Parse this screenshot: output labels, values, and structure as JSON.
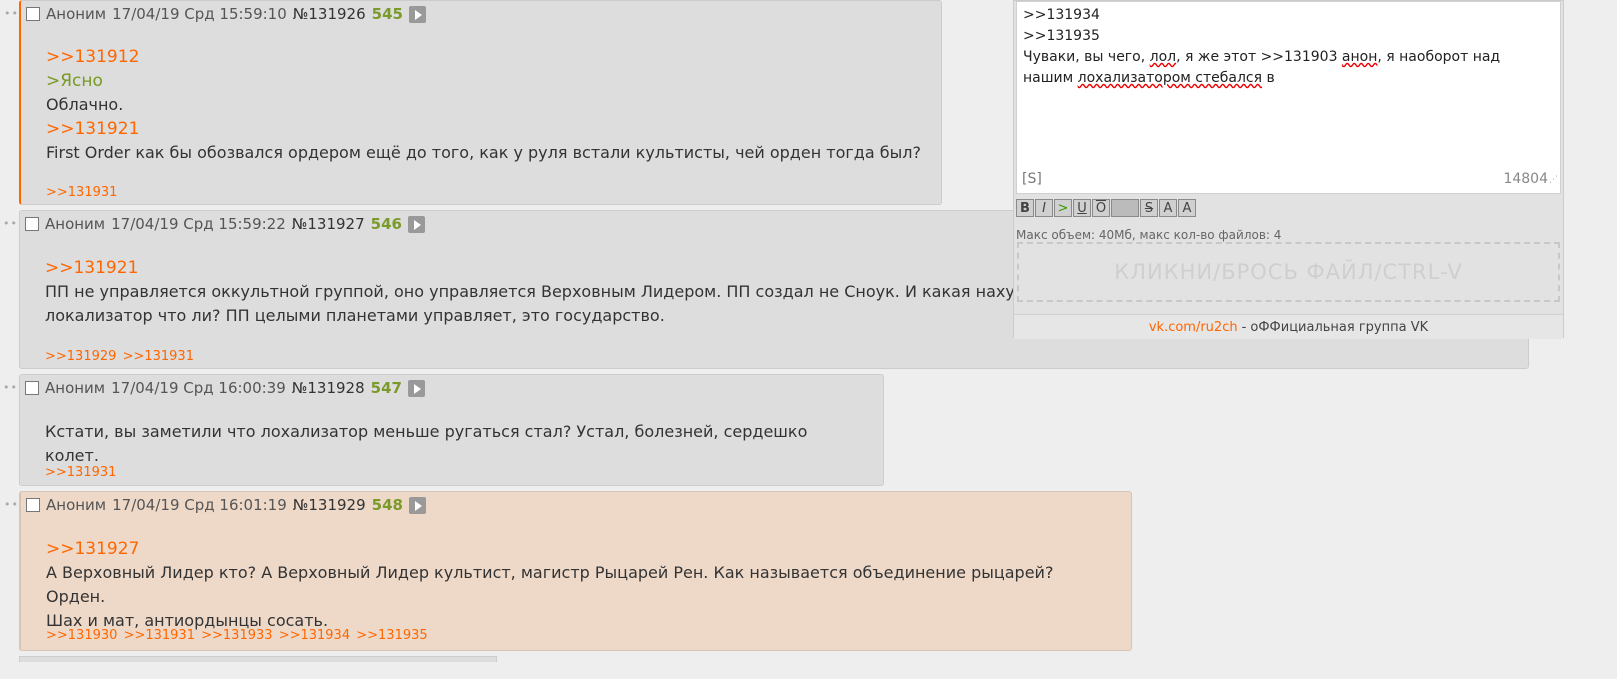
{
  "posts": [
    {
      "name": "Аноним",
      "date": "17/04/19 Срд 15:59:10",
      "num": "№131926",
      "count": "545",
      "body": [
        {
          "type": "reply",
          "text": ">>131912"
        },
        {
          "type": "quote",
          "text": ">Ясно"
        },
        {
          "type": "text",
          "text": "Облачно."
        },
        {
          "type": "reply",
          "text": ">>131921"
        },
        {
          "type": "text",
          "text": "First Order как бы обозвался ордером ещё до того, как у руля встали культисты, чей орден тогда был?"
        }
      ],
      "replies": [
        ">>131931"
      ]
    },
    {
      "name": "Аноним",
      "date": "17/04/19 Срд 15:59:22",
      "num": "№131927",
      "count": "546",
      "body": [
        {
          "type": "reply",
          "text": ">>131921"
        },
        {
          "type": "text",
          "text": "ПП не управляется оккультной группой, оно управляется Верховным Лидером. ПП создал не Сноук. И какая нахуй"
        },
        {
          "type": "text",
          "text": "локализатор что ли? ПП целыми планетами управляет, это государство."
        }
      ],
      "replies": [
        ">>131929",
        ">>131931"
      ]
    },
    {
      "name": "Аноним",
      "date": "17/04/19 Срд 16:00:39",
      "num": "№131928",
      "count": "547",
      "body": [
        {
          "type": "text",
          "text": "Кстати, вы заметили что лохализатор меньше ругаться стал? Устал, болезней, сердешко колет."
        }
      ],
      "replies": [
        ">>131931"
      ]
    },
    {
      "name": "Аноним",
      "date": "17/04/19 Срд 16:01:19",
      "num": "№131929",
      "count": "548",
      "body": [
        {
          "type": "reply",
          "text": ">>131927"
        },
        {
          "type": "text",
          "text": "А Верховный Лидер кто? А Верховный Лидер культист, магистр Рыцарей Рен. Как называется объединение рыцарей? Орден."
        },
        {
          "type": "text",
          "text": "Шах и мат, антиордынцы сосать."
        }
      ],
      "replies": [
        ">>131930",
        ">>131931",
        ">>131933",
        ">>131934",
        ">>131935"
      ]
    }
  ],
  "reply_form": {
    "lines": [
      ">>131934",
      ">>131935"
    ],
    "line3_a": "Чуваки, вы чего, ",
    "line3_b": "лол",
    "line3_c": ", я же этот >>131903 ",
    "line3_d": "анон",
    "line3_e": ", я наоборот над",
    "line4_a": "нашим ",
    "line4_b": "лохализатором стебался",
    "line4_c": " в",
    "sage_label": "[S]",
    "char_count": "14804",
    "toolbar": {
      "bold": "B",
      "italic": "I",
      "quote": ">",
      "underline": "U",
      "overline": "O",
      "spoiler": "",
      "strike": "S",
      "sup": "A",
      "sub": "A"
    },
    "file_limits": "Макс объем: 40Мб, макс кол-во файлов: 4",
    "dropzone": "КЛИКНИ/БРОСЬ ФАЙЛ/CTRL-V",
    "footer_link": "vk.com/ru2ch",
    "footer_text": "- оФФициальная группа VK"
  }
}
